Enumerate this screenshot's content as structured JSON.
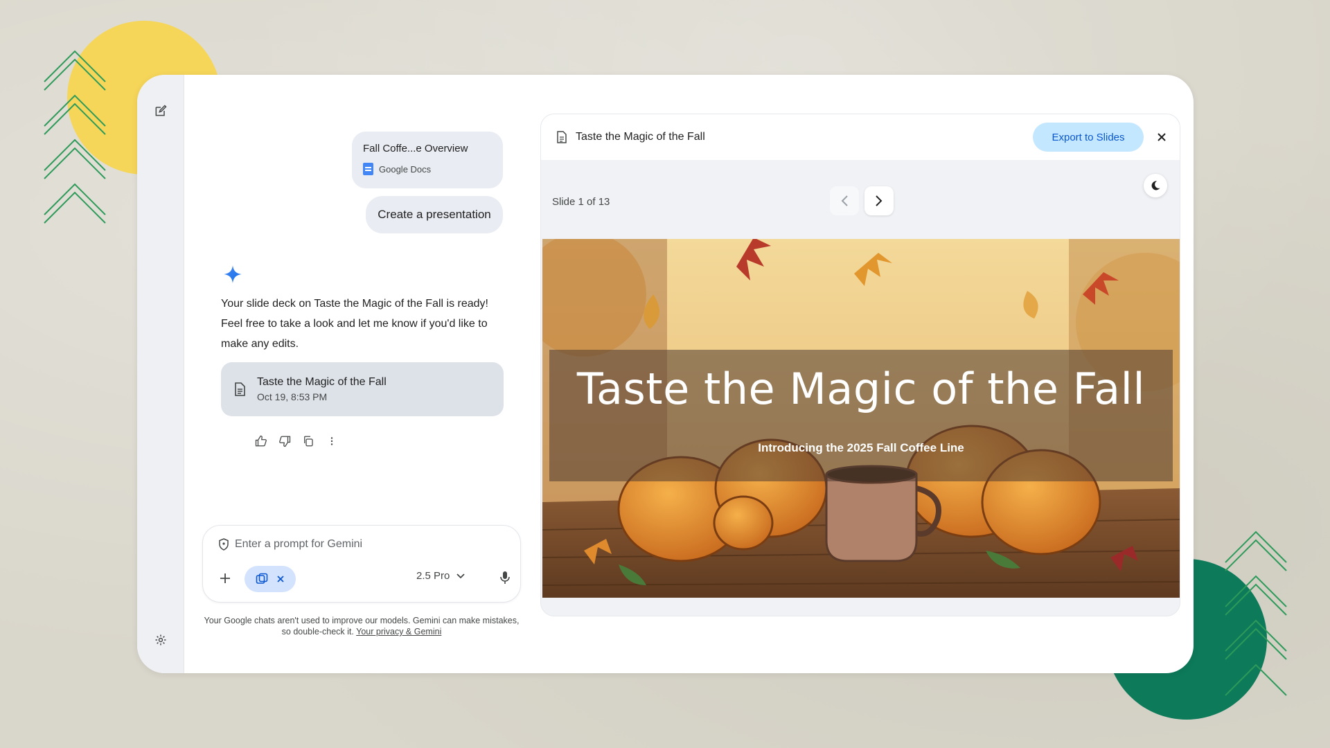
{
  "chat": {
    "attachment": {
      "name": "Fall Coffe...e Overview",
      "source": "Google Docs"
    },
    "user_message": "Create a presentation",
    "reply": "Your slide deck on Taste the Magic of the Fall is ready! Feel free to take a look and let me know if you'd like to make any edits.",
    "deck_card": {
      "title": "Taste the Magic of the Fall",
      "date": "Oct 19, 8:53 PM"
    }
  },
  "prompt": {
    "placeholder": "Enter a prompt for Gemini",
    "model": "2.5 Pro"
  },
  "disclaimer": {
    "text": "Your Google chats aren't used to improve our models. Gemini can make mistakes, so double-check it.",
    "link": "Your privacy & Gemini"
  },
  "panel": {
    "title": "Taste the Magic of the Fall",
    "export_label": "Export to Slides",
    "slide_counter": "Slide 1 of 13"
  },
  "slide": {
    "title": "Taste the Magic of the Fall",
    "subtitle": "Introducing the 2025 Fall Coffee Line"
  },
  "colors": {
    "accent": "#0b57d0",
    "export_bg": "#c2e7ff",
    "deco_yellow": "#f5d659",
    "deco_green": "#0d7a5a"
  },
  "icons": {
    "new_chat": "edit-icon",
    "settings": "gear-icon",
    "gemini": "sparkle-icon"
  }
}
